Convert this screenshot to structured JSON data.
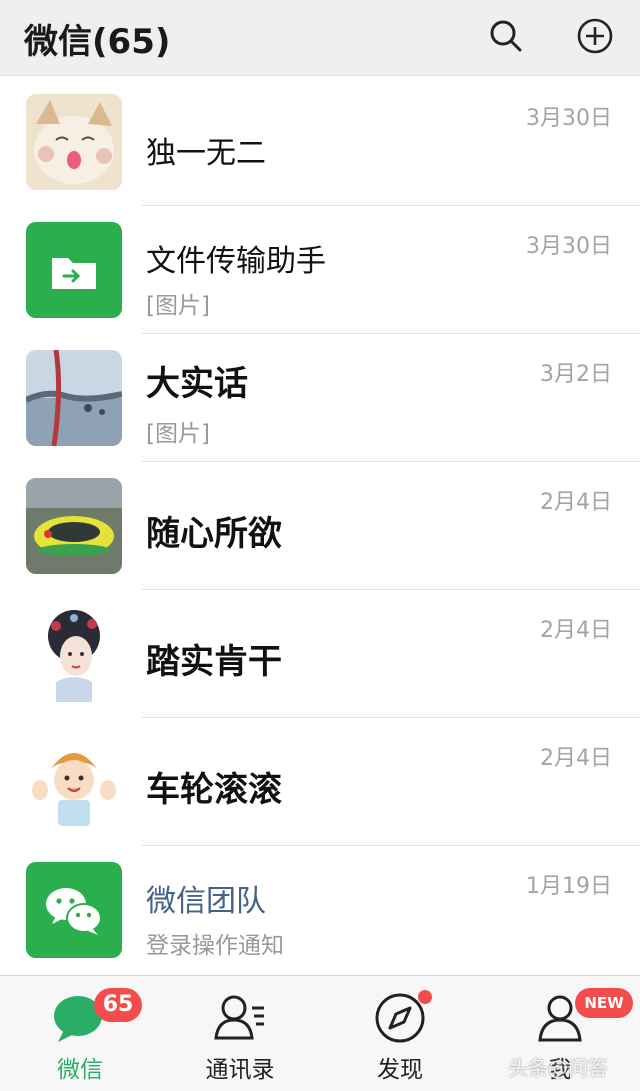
{
  "header": {
    "title": "微信(65)",
    "search_icon": "search-icon",
    "add_icon": "plus-circle-icon"
  },
  "chats": [
    {
      "name": "独一无二",
      "preview": "",
      "date": "3月30日",
      "avatar": "cat-photo"
    },
    {
      "name": "文件传输助手",
      "preview": "[图片]",
      "date": "3月30日",
      "avatar": "folder-arrow-icon"
    },
    {
      "name": "大实话",
      "preview": "[图片]",
      "date": "3月2日",
      "avatar": "landscape-photo"
    },
    {
      "name": "随心所欲",
      "preview": "",
      "date": "2月4日",
      "avatar": "bumper-car-photo"
    },
    {
      "name": "踏实肯干",
      "preview": "",
      "date": "2月4日",
      "avatar": "opera-girl-illustration"
    },
    {
      "name": "车轮滚滚",
      "preview": "",
      "date": "2月4日",
      "avatar": "cartoon-boy-illustration"
    },
    {
      "name": "微信团队",
      "preview": "登录操作通知",
      "date": "1月19日",
      "avatar": "wechat-logo-icon"
    }
  ],
  "tabbar": {
    "tabs": [
      {
        "label": "微信",
        "badge": "65",
        "icon": "chat-bubble-icon",
        "active": true
      },
      {
        "label": "通讯录",
        "icon": "contacts-icon"
      },
      {
        "label": "发现",
        "icon": "compass-icon",
        "dot": true
      },
      {
        "label": "我",
        "badge": "NEW",
        "icon": "person-icon"
      }
    ]
  },
  "watermark": "头条@问答",
  "colors": {
    "accent": "#2aae67",
    "badge": "#f24c4c",
    "header_bg": "#efefef",
    "link_name": "#44618a"
  }
}
